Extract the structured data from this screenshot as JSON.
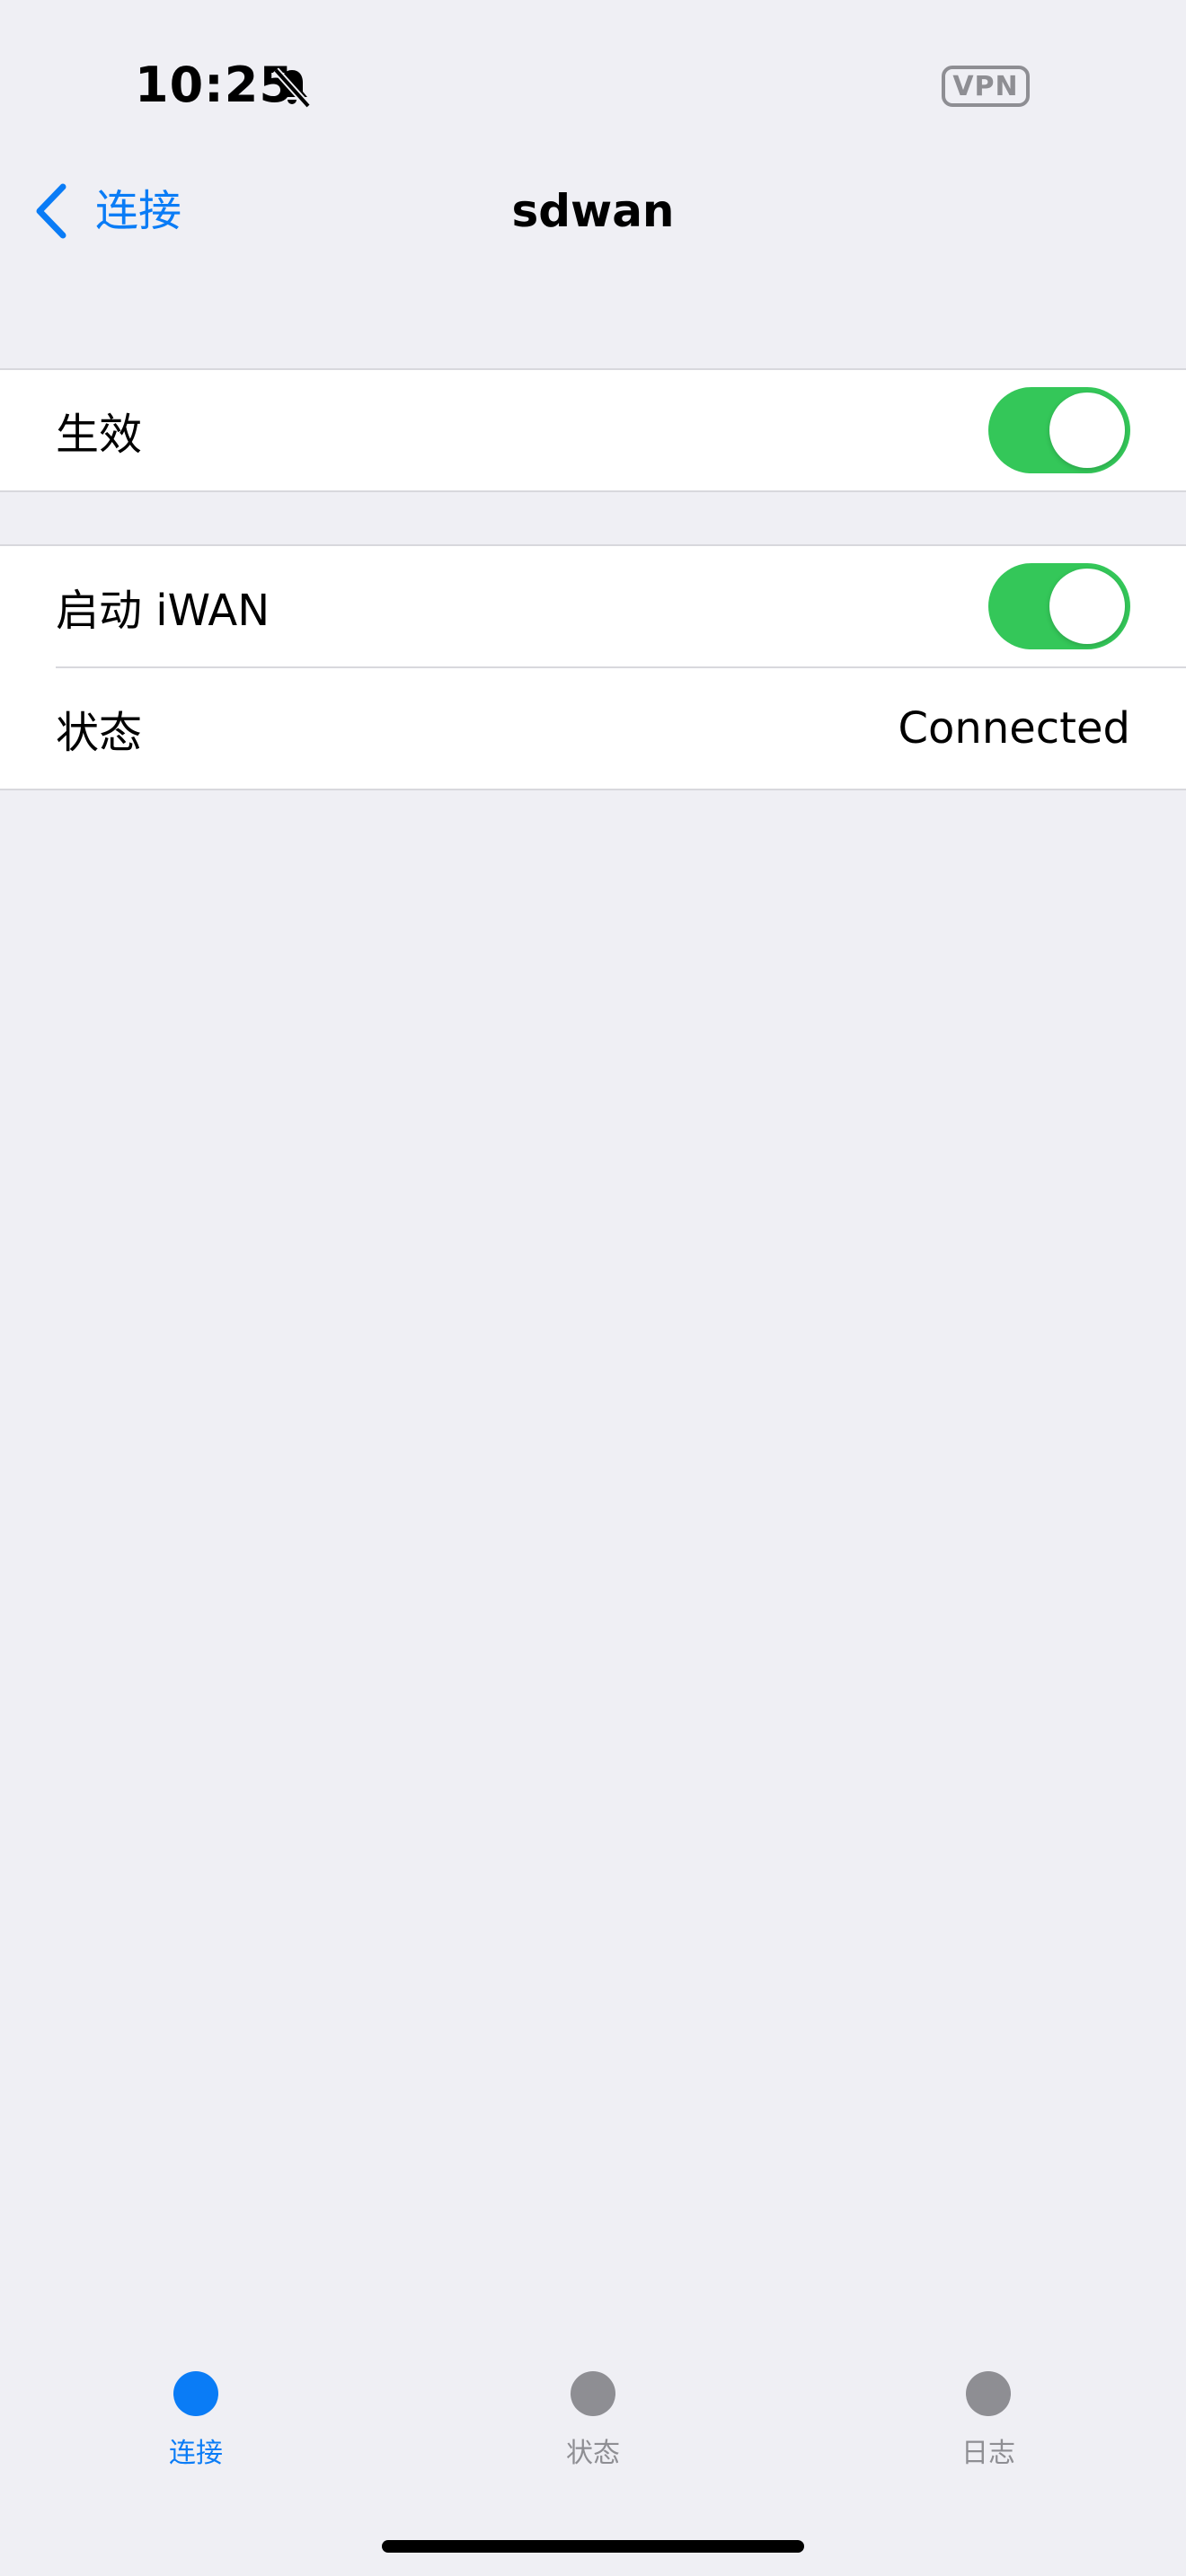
{
  "status_bar": {
    "time": "10:25",
    "vpn_label": "VPN"
  },
  "nav": {
    "back_label": "连接",
    "title": "sdwan"
  },
  "group1": {
    "enable_label": "生效",
    "enable_on": true
  },
  "group2": {
    "iwan_label": "启动 iWAN",
    "iwan_on": true,
    "status_label": "状态",
    "status_value": "Connected"
  },
  "tabs": [
    {
      "label": "连接",
      "active": true
    },
    {
      "label": "状态",
      "active": false
    },
    {
      "label": "日志",
      "active": false
    }
  ],
  "colors": {
    "accent": "#0A7CF6",
    "toggle_on": "#34C759",
    "inactive": "#8E8E93",
    "background": "#EFEFF4"
  }
}
